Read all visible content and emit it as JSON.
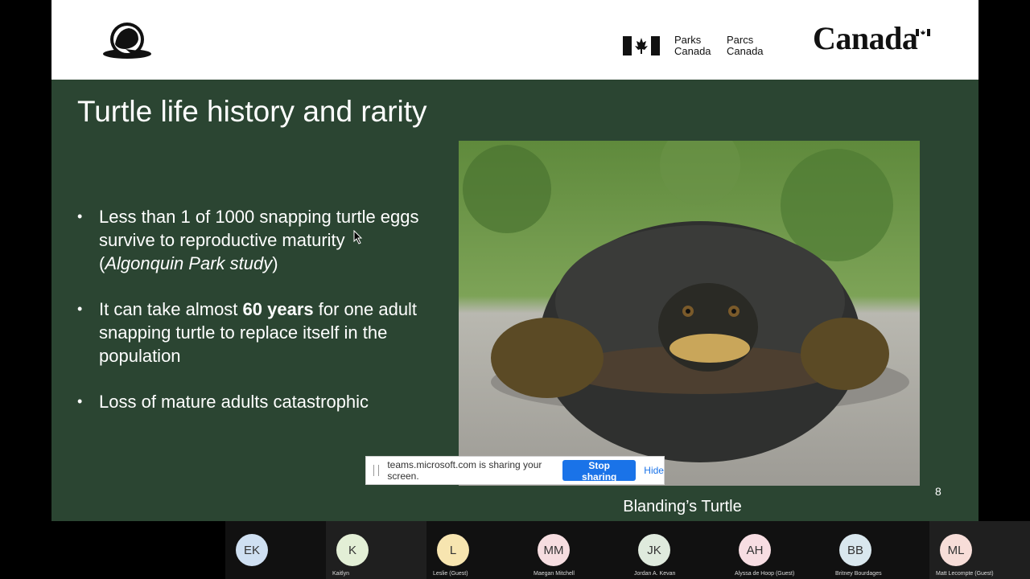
{
  "header": {
    "parks_en_line1": "Parks",
    "parks_en_line2": "Canada",
    "parks_fr_line1": "Parcs",
    "parks_fr_line2": "Canada",
    "wordmark": "Canada"
  },
  "slide": {
    "title": "Turtle life history and rarity",
    "bullet1": {
      "line1": "Less than 1 of 1000 snapping turtle eggs survive to reproductive maturity (",
      "italic": "Algonquin Park study",
      "end": ")"
    },
    "bullet2": {
      "before": "It can take almost ",
      "bold": "60 years",
      "after": " for one adult snapping turtle to replace itself in the population"
    },
    "bullet3": "Loss of mature adults catastrophic",
    "caption": "Blanding’s Turtle",
    "page_number": "8"
  },
  "sharing_bar": {
    "message": "teams.microsoft.com is sharing your screen.",
    "stop_label": "Stop sharing",
    "hide_label": "Hide"
  },
  "participants": [
    {
      "initials": "EK",
      "name": "",
      "color": "#cfe0f2"
    },
    {
      "initials": "K",
      "name": "Kaitlyn",
      "color": "#e3efd6"
    },
    {
      "initials": "L",
      "name": "Leslie (Guest)",
      "color": "#f7e5b0"
    },
    {
      "initials": "MM",
      "name": "Maegan Mitchell",
      "color": "#f6dde0"
    },
    {
      "initials": "JK",
      "name": "Jordan A. Kevan",
      "color": "#dfeadd"
    },
    {
      "initials": "AH",
      "name": "Alyssa de Hoop (Guest)",
      "color": "#f7dde2"
    },
    {
      "initials": "BB",
      "name": "Britney Bourdages",
      "color": "#d9e7ee"
    },
    {
      "initials": "ML",
      "name": "Matt Lecompte (Guest)",
      "color": "#f7ddd8"
    }
  ]
}
